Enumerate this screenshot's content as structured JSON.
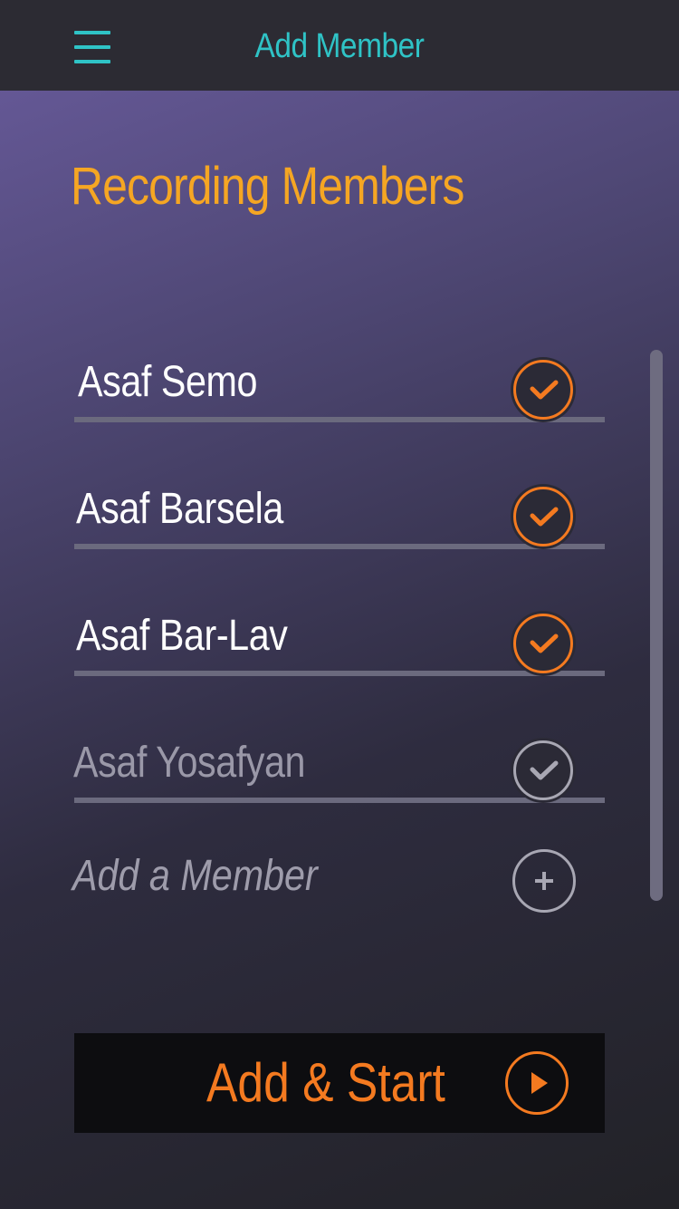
{
  "header": {
    "title": "Add Member",
    "menu_icon": "hamburger-menu-icon",
    "accent_color": "#2fc3c6"
  },
  "section": {
    "title": "Recording Members",
    "title_color": "#f5a623"
  },
  "members": [
    {
      "name": "Asaf Semo",
      "selected": true,
      "icon": "check-icon"
    },
    {
      "name": "Asaf Barsela",
      "selected": true,
      "icon": "check-icon"
    },
    {
      "name": "Asaf Bar-Lav",
      "selected": true,
      "icon": "check-icon"
    },
    {
      "name": "Asaf Yosafyan",
      "selected": false,
      "icon": "check-icon"
    }
  ],
  "add_member": {
    "label": "Add a Member",
    "icon": "plus-icon"
  },
  "start_button": {
    "label": "Add & Start",
    "icon": "play-icon",
    "color": "#f47a20"
  }
}
